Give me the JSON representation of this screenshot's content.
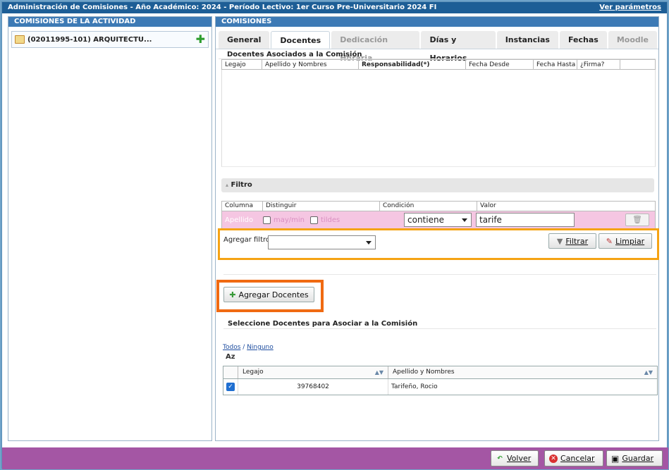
{
  "window": {
    "title": "Administración de Comisiones - Año Académico: 2024 - Período Lectivo: 1er Curso Pre-Universitario 2024 FI",
    "params_link": "Ver parámetros"
  },
  "left": {
    "header": "COMISIONES DE LA ACTIVIDAD",
    "item_label": "(02011995-101) ARQUITECTU..."
  },
  "right": {
    "header": "COMISIONES",
    "tabs": [
      {
        "label": "General",
        "state": "normal"
      },
      {
        "label": "Docentes",
        "state": "active"
      },
      {
        "label": "Dedicación Horaria",
        "state": "disabled"
      },
      {
        "label": "Días y Horarios",
        "state": "normal"
      },
      {
        "label": "Instancias",
        "state": "normal"
      },
      {
        "label": "Fechas",
        "state": "normal"
      },
      {
        "label": "Moodle",
        "state": "disabled"
      }
    ],
    "associated": {
      "title": "Docentes Asociados a la Comisión",
      "columns": [
        "Legajo",
        "Apellido y Nombres",
        "Responsabilidad(*)",
        "Fecha Desde",
        "Fecha Hasta",
        "¿Firma?"
      ]
    },
    "filter": {
      "title": "Filtro",
      "columns": [
        "Columna",
        "Distinguir",
        "Condición",
        "Valor"
      ],
      "row": {
        "column": "Apellido",
        "case_label": "may/min",
        "accent_label": "tildes",
        "condition": "contiene",
        "value": "tarife"
      },
      "add_label": "Agregar filtro",
      "add_value": "",
      "filter_button": "Filtrar",
      "clear_button": "Limpiar"
    },
    "add_teachers_button": "Agregar Docentes",
    "select": {
      "title": "Seleccione Docentes para Asociar a la Comisión",
      "all_link": "Todos",
      "separator": "/",
      "none_link": "Ninguno",
      "sort_label": "Az",
      "columns": [
        "Legajo",
        "Apellido y Nombres"
      ],
      "rows": [
        {
          "checked": true,
          "legajo": "39768402",
          "nombre": "Tarifeño, Rocio"
        }
      ]
    }
  },
  "footer": {
    "back": "Volver",
    "cancel": "Cancelar",
    "save": "Guardar"
  },
  "colors": {
    "title_bar": "#1d5e96",
    "footer": "#a456a4",
    "filter_row": "#f5c6e2",
    "highlight_filter": "#f5a314",
    "highlight_add": "#f06a12"
  }
}
